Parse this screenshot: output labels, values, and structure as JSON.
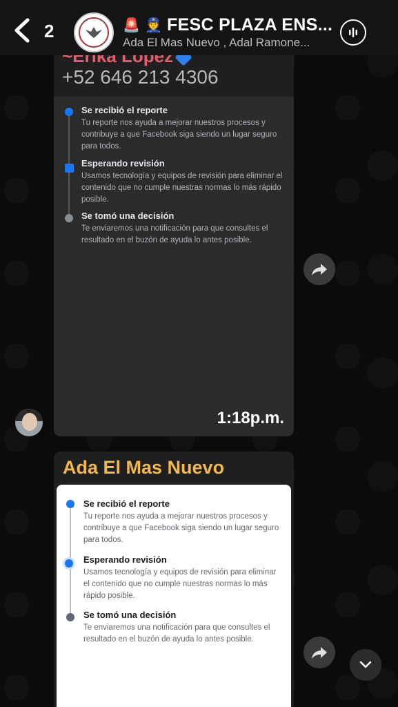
{
  "header": {
    "back_count": "2",
    "emoji_1": "🚨",
    "emoji_2": "👮",
    "title": "FESC PLAZA ENS...",
    "subtitle": "Ada El Mas Nuevo , Adal Ramone..."
  },
  "messages": [
    {
      "sender": "~Erika López",
      "phone": "+52 646 213 4306",
      "time": "1:18p.m.",
      "report_steps": [
        {
          "title": "Se recibió el reporte",
          "desc": "Tu reporte nos ayuda a mejorar nuestros procesos y contribuye a que Facebook siga siendo un lugar seguro para todos."
        },
        {
          "title": "Esperando revisión",
          "desc": "Usamos tecnología y equipos de revisión para eliminar el contenido que no cumple nuestras normas lo más rápido posible."
        },
        {
          "title": "Se tomó una decisión",
          "desc": "Te enviaremos una notificación para que consultes el resultado en el buzón de ayuda lo antes posible."
        }
      ]
    },
    {
      "sender": "Ada El Mas Nuevo",
      "report_steps": [
        {
          "title": "Se recibió el reporte",
          "desc": "Tu reporte nos ayuda a mejorar nuestros procesos y contribuye a que Facebook siga siendo un lugar seguro para todos."
        },
        {
          "title": "Esperando revisión",
          "desc": "Usamos tecnología y equipos de revisión para eliminar el contenido que no cumple nuestras normas lo más rápido posible."
        },
        {
          "title": "Se tomó una decisión",
          "desc": "Te enviaremos una notificación para que consultes el resultado en el buzón de ayuda lo antes posible."
        }
      ]
    }
  ],
  "colors": {
    "step_active": "#1877f2",
    "step_pending": "#8a8d91",
    "sender_1": "#e35d6a",
    "sender_2": "#f2b84b"
  }
}
